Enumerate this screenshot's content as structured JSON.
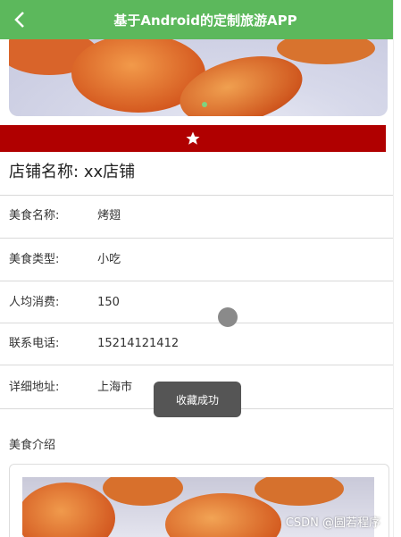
{
  "appbar": {
    "title": "基于Android的定制旅游APP",
    "back_icon": "chevron-left-icon"
  },
  "favorite": {
    "icon": "star-icon",
    "color": "#b00000"
  },
  "shop": {
    "label": "店铺名称:",
    "name": "xx店铺"
  },
  "details": [
    {
      "label": "美食名称:",
      "value": "烤翅"
    },
    {
      "label": "美食类型:",
      "value": "小吃"
    },
    {
      "label": "人均消费:",
      "value": "150"
    },
    {
      "label": "联系电话:",
      "value": "15214121412"
    },
    {
      "label": "详细地址:",
      "value": "上海市"
    }
  ],
  "intro": {
    "title": "美食介绍"
  },
  "toast": {
    "text": "收藏成功"
  },
  "watermark": "CSDN @圆若程序",
  "colors": {
    "appbar": "#5cb85c",
    "fav_bar": "#b00000"
  }
}
